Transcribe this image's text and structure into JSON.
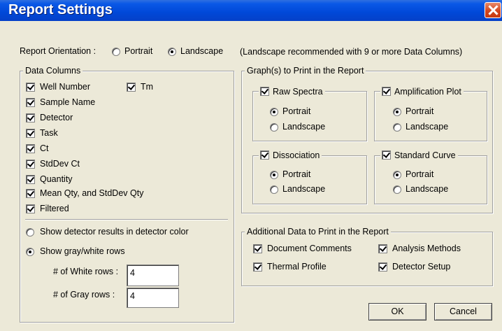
{
  "window": {
    "title": "Report Settings"
  },
  "orientation": {
    "label": "Report Orientation :",
    "portrait": "Portrait",
    "landscape": "Landscape",
    "selected": "Landscape",
    "note": "(Landscape recommended with 9 or more Data Columns)"
  },
  "data_columns": {
    "title": "Data Columns",
    "items": [
      {
        "label": "Well Number",
        "checked": true
      },
      {
        "label": "Sample Name",
        "checked": true
      },
      {
        "label": "Detector",
        "checked": true
      },
      {
        "label": "Task",
        "checked": true
      },
      {
        "label": "Ct",
        "checked": true
      },
      {
        "label": "StdDev Ct",
        "checked": true
      },
      {
        "label": "Quantity",
        "checked": true
      },
      {
        "label": "Mean Qty, and StdDev Qty",
        "checked": true
      },
      {
        "label": "Filtered",
        "checked": true
      },
      {
        "label": "Tm",
        "checked": true
      }
    ],
    "show_detector_color": "Show detector results in detector color",
    "show_gray_white": "Show gray/white rows",
    "selected_row_mode": "gray-white",
    "white_rows_label": "# of White rows :",
    "white_rows_value": "4",
    "gray_rows_label": "# of Gray rows :",
    "gray_rows_value": "4"
  },
  "graphs": {
    "title": "Graph(s) to Print in the Report",
    "portrait": "Portrait",
    "landscape": "Landscape",
    "items": [
      {
        "label": "Raw Spectra",
        "checked": true,
        "orientation": "Portrait"
      },
      {
        "label": "Amplification Plot",
        "checked": true,
        "orientation": "Portrait"
      },
      {
        "label": "Dissociation",
        "checked": true,
        "orientation": "Portrait"
      },
      {
        "label": "Standard Curve",
        "checked": true,
        "orientation": "Portrait"
      }
    ]
  },
  "additional": {
    "title": "Additional Data to Print in the Report",
    "items": [
      {
        "label": "Document Comments",
        "checked": true
      },
      {
        "label": "Analysis Methods",
        "checked": true
      },
      {
        "label": "Thermal Profile",
        "checked": true
      },
      {
        "label": "Detector Setup",
        "checked": true
      }
    ]
  },
  "buttons": {
    "ok": "OK",
    "cancel": "Cancel"
  }
}
